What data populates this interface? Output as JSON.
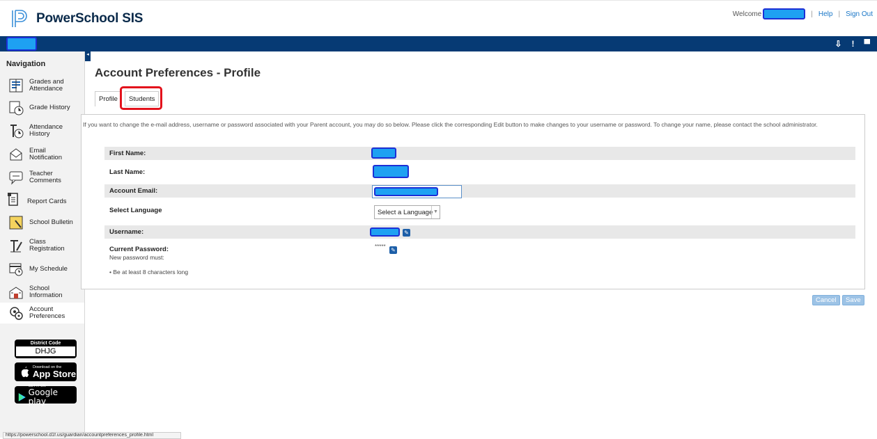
{
  "app": {
    "title": "PowerSchool SIS"
  },
  "topbar": {
    "welcome": "Welcome",
    "help": "Help",
    "sign_out": "Sign Out"
  },
  "nav": {
    "title": "Navigation",
    "items": [
      {
        "label": "Grades and Attendance",
        "icon": "grades-icon"
      },
      {
        "label": "Grade History",
        "icon": "history-icon"
      },
      {
        "label": "Attendance History",
        "icon": "attendance-icon"
      },
      {
        "label": "Email Notification",
        "icon": "email-icon"
      },
      {
        "label": "Teacher Comments",
        "icon": "comments-icon"
      },
      {
        "label": "Report Cards",
        "icon": "report-icon"
      },
      {
        "label": "School Bulletin",
        "icon": "bulletin-icon"
      },
      {
        "label": "Class Registration",
        "icon": "registration-icon"
      },
      {
        "label": "My Schedule",
        "icon": "schedule-icon"
      },
      {
        "label": "School Information",
        "icon": "school-icon"
      },
      {
        "label": "Account Preferences",
        "icon": "preferences-icon"
      }
    ]
  },
  "district": {
    "label": "District Code",
    "code": "DHJG"
  },
  "appstore": {
    "small": "Download on the",
    "big": "App Store"
  },
  "googleplay": {
    "small": "GET IT ON",
    "big": "Google play"
  },
  "page": {
    "title": "Account Preferences - Profile",
    "tabs": [
      "Profile",
      "Students"
    ],
    "intro": "If you want to change the e-mail address, username or password associated with your Parent account, you may do so below. Please click the corresponding Edit button to make changes to your username or password. To change your name, please contact the school administrator.",
    "fields": {
      "first_name": "First Name:",
      "last_name": "Last Name:",
      "account_email": "Account Email:",
      "select_language": "Select Language",
      "username": "Username:",
      "current_password": "Current Password:",
      "password_mask": "*****",
      "new_password_must": "New password must:",
      "rule": "• Be at least 8 characters long"
    },
    "language_select": {
      "value": "Select a Language"
    },
    "cancel": "Cancel",
    "save": "Save"
  },
  "status_url": "https://powerschool.d1f.us/guardian/accountpreferences_profile.html",
  "colors": {
    "accent": "#063a74",
    "highlight": "#e3121c",
    "redaction": "#1ea1f2"
  }
}
